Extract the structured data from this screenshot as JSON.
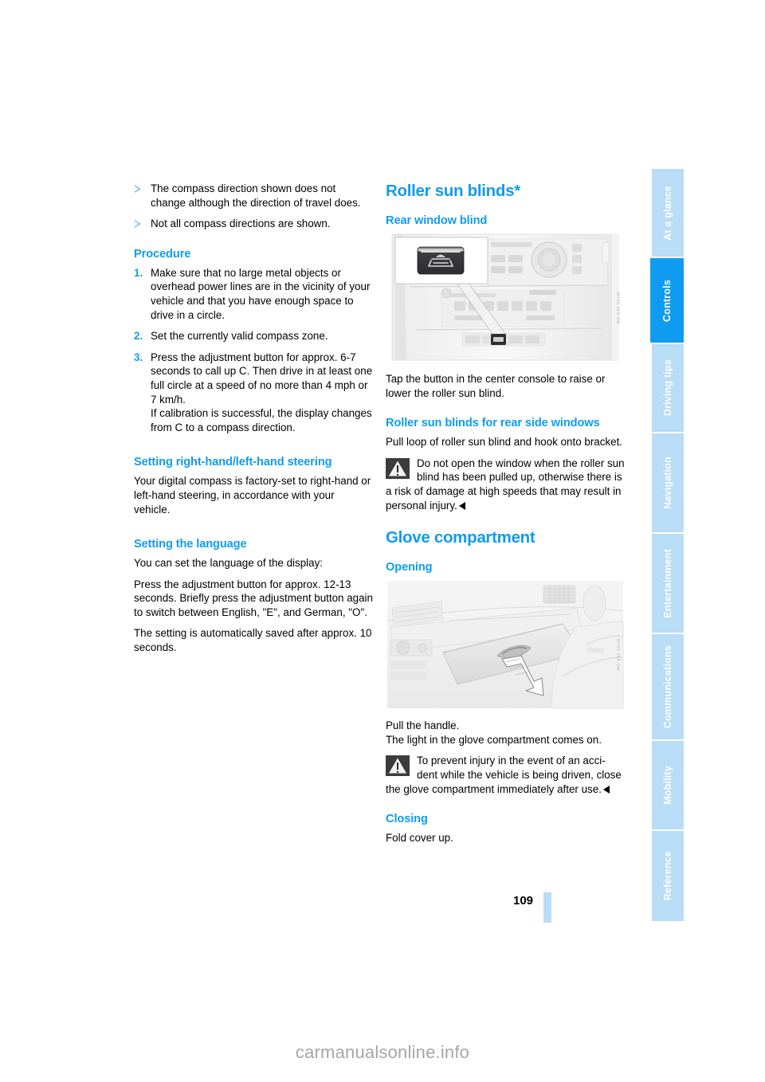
{
  "page": {
    "number": "109",
    "bottom_watermark": "carmanualsonline.info"
  },
  "tabs": [
    {
      "label": "At a glance",
      "active": false
    },
    {
      "label": "Controls",
      "active": true
    },
    {
      "label": "Driving tips",
      "active": false
    },
    {
      "label": "Navigation",
      "active": false
    },
    {
      "label": "Entertainment",
      "active": false
    },
    {
      "label": "Communications",
      "active": false
    },
    {
      "label": "Mobility",
      "active": false
    },
    {
      "label": "Reference",
      "active": false
    }
  ],
  "colors": {
    "accent": "#0f9cf0",
    "tab_inactive": "#b9dcf7",
    "bullet": "#7fc4f2",
    "warning_icon": "#3c3c3c"
  },
  "left_column": {
    "bullets": [
      "The compass direction shown does not change although the direction of travel does.",
      "Not all compass directions are shown."
    ],
    "procedure_heading": "Procedure",
    "procedure_steps": [
      {
        "num": "1.",
        "text": "Make sure that no large metal objects or overhead power lines are in the vicinity of your vehicle and that you have enough space to drive in a circle."
      },
      {
        "num": "2.",
        "text": "Set the currently valid compass zone."
      },
      {
        "num": "3.",
        "text": "Press the adjustment button for approx. 6-7 seconds to call up C. Then drive in at least one full circle at a speed of no more than 4 mph or 7 km/h.\nIf calibration is successful, the display changes from C to a compass direction."
      }
    ],
    "steering_heading": "Setting right-hand/left-hand steering",
    "steering_body": "Your digital compass is factory-set to right-hand or left-hand steering, in accordance with your vehicle.",
    "language_heading": "Setting the language",
    "language_body1": "You can set the language of the display:",
    "language_body2": "Press the adjustment button for approx. 12-13 seconds. Briefly press the adjustment button again to switch between English, \"E\", and German, \"O\".",
    "language_body3": "The setting is automatically saved after approx. 10 seconds."
  },
  "right_column": {
    "roller_heading": "Roller sun blinds*",
    "rear_window_heading": "Rear window blind",
    "figure1": {
      "alt": "Center console with rear window blind button callout",
      "watermark": "MY09 3ER OM"
    },
    "rear_window_body": "Tap the button in the center console to raise or lower the roller sun blind.",
    "side_windows_heading": "Roller sun blinds for rear side windows",
    "side_windows_body": "Pull loop of roller sun blind and hook onto bracket.",
    "side_windows_warning_lead": "Do not open the window when the roller sun blind has been pulled up, otherwise",
    "side_windows_warning_rest": "there is a risk of damage at high speeds that may result in personal injury.",
    "glove_heading": "Glove compartment",
    "opening_heading": "Opening",
    "figure2": {
      "alt": "Dashboard glove compartment being opened with arrow",
      "watermark": "MY09 3ER OM"
    },
    "opening_body1": "Pull the handle.",
    "opening_body2": "The light in the glove compartment comes on.",
    "opening_warning_lead": "To prevent injury in the event of an acci-dent while the vehicle is being driven,",
    "opening_warning_rest": "close the glove compartment immediately after use.",
    "closing_heading": "Closing",
    "closing_body": "Fold cover up."
  }
}
